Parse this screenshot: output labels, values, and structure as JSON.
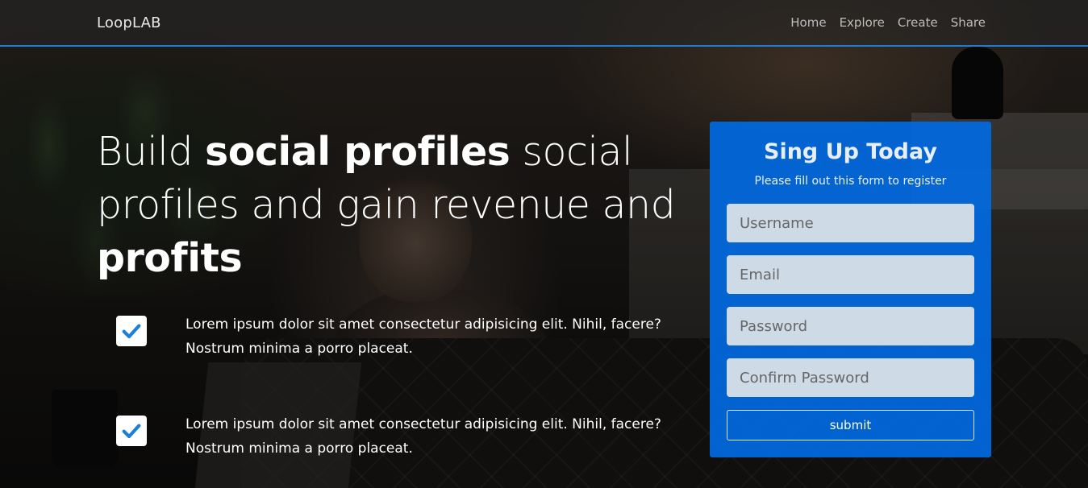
{
  "navbar": {
    "brand": "LoopLAB",
    "links": [
      "Home",
      "Explore",
      "Create",
      "Share"
    ]
  },
  "hero": {
    "title_parts": {
      "p1": "Build ",
      "p2": "social profiles",
      "p3": " social profiles and gain revenue and ",
      "p4": "profits"
    },
    "features": [
      {
        "text": "Lorem ipsum dolor sit amet consectetur adipisicing elit. Nihil, facere? Nostrum minima a porro placeat.",
        "icon": "checkmark-icon"
      },
      {
        "text": "Lorem ipsum dolor sit amet consectetur adipisicing elit. Nihil, facere? Nostrum minima a porro placeat.",
        "icon": "checkmark-icon"
      }
    ]
  },
  "signup": {
    "title": "Sing Up Today",
    "subtitle": "Please fill out this form to register",
    "username_placeholder": "Username",
    "email_placeholder": "Email",
    "password_placeholder": "Password",
    "confirm_placeholder": "Confirm Password",
    "submit_label": "submit"
  },
  "colors": {
    "accent": "#1d7bd3",
    "card": "#006ce6",
    "check": "#1e7fd6"
  }
}
